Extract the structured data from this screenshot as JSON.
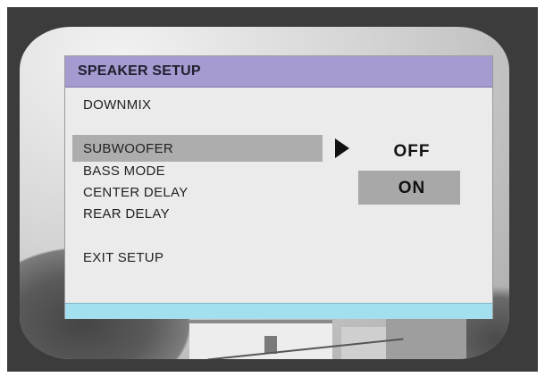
{
  "menu": {
    "title": "SPEAKER SETUP",
    "items": [
      {
        "label": "DOWNMIX"
      },
      {
        "label": "SUBWOOFER",
        "selected": true
      },
      {
        "label": "BASS MODE"
      },
      {
        "label": "CENTER DELAY"
      },
      {
        "label": "REAR DELAY"
      },
      {
        "label": "EXIT SETUP"
      }
    ]
  },
  "submenu": {
    "options": [
      {
        "label": "OFF"
      },
      {
        "label": "ON",
        "highlighted": true
      }
    ]
  },
  "colors": {
    "title_bar": "#a59bd0",
    "footer_bar": "#a4dff0",
    "panel": "#ebebeb",
    "selection": "#adadad",
    "bezel": "#3c3c3c"
  }
}
